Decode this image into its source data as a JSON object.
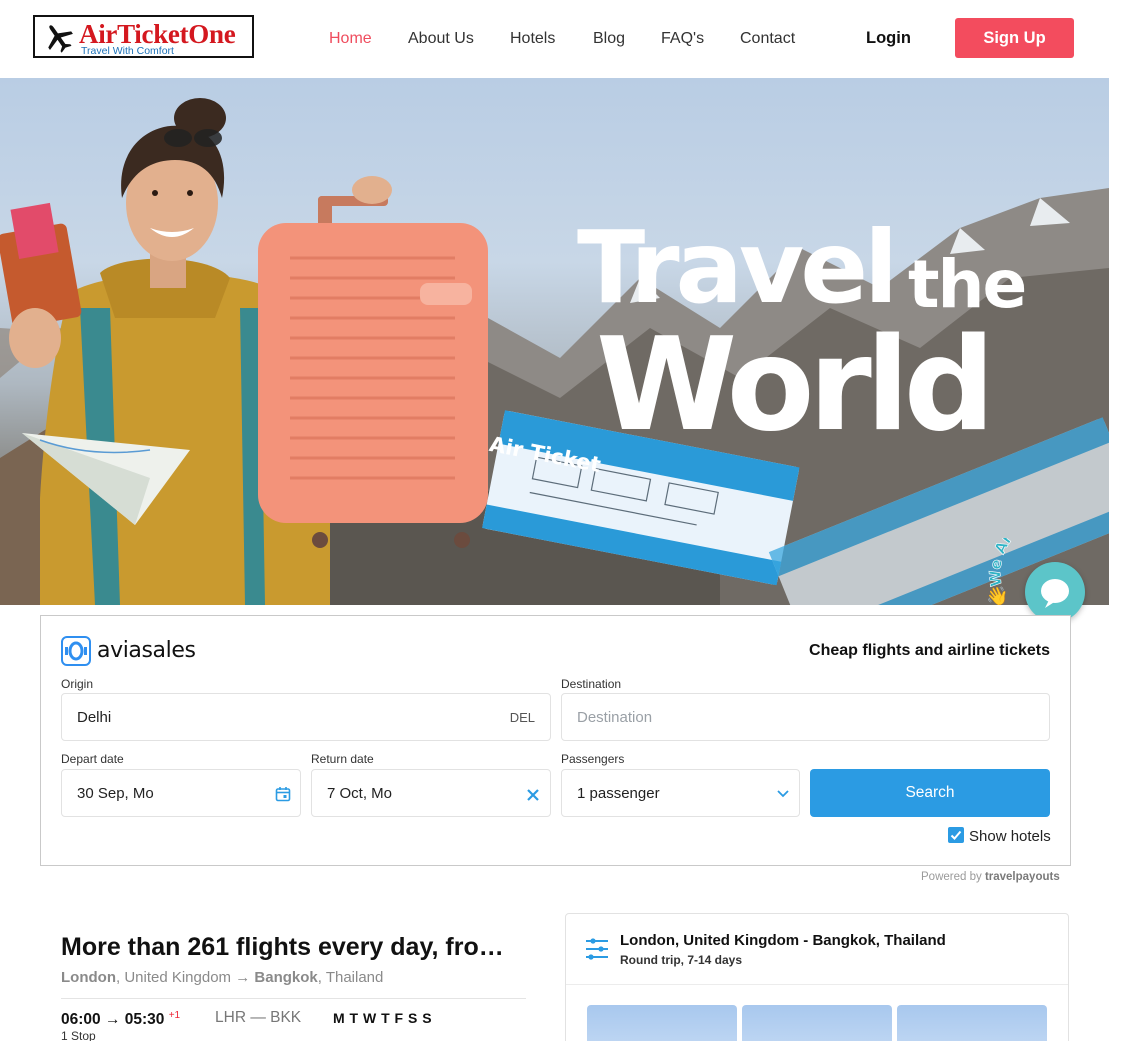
{
  "header": {
    "logo_name": "AirTicketOne",
    "logo_tagline": "Travel With Comfort",
    "nav": [
      "Home",
      "About Us",
      "Hotels",
      "Blog",
      "FAQ's",
      "Contact"
    ],
    "active_nav": "Home",
    "login_label": "Login",
    "signup_label": "Sign Up",
    "accent_color": "#f34c5e"
  },
  "hero": {
    "title_line1": "Travel",
    "title_line1b": "the",
    "title_line2": "World",
    "ticket_text": "Air Ticket",
    "chat_badge": "We Are Here!"
  },
  "search": {
    "brand": "aviasales",
    "slogan": "Cheap flights and airline tickets",
    "origin_label": "Origin",
    "origin_value": "Delhi",
    "origin_code": "DEL",
    "destination_label": "Destination",
    "destination_placeholder": "Destination",
    "depart_label": "Depart date",
    "depart_value": "30 Sep, Mo",
    "return_label": "Return date",
    "return_value": "7 Oct, Mo",
    "passengers_label": "Passengers",
    "passengers_value": "1 passenger",
    "search_button": "Search",
    "show_hotels_label": "Show hotels",
    "show_hotels_checked": true,
    "powered_by": "Powered by",
    "powered_brand": "travelpayouts",
    "button_color": "#2b9be3"
  },
  "flights": {
    "title": "More than 261 flights every day, fro…",
    "origin_city": "London",
    "origin_country": ", United Kingdom →",
    "dest_city": "Bangkok",
    "dest_country": ", Thailand",
    "depart_time": "06:00 → 05:30",
    "next_day": "+1",
    "airports": "LHR — BKK",
    "days": "M T W T F S S",
    "stops": "1 Stop"
  },
  "route_card": {
    "title": "London, United Kingdom - Bangkok, Thailand",
    "subtitle": "Round trip, 7-14 days"
  }
}
